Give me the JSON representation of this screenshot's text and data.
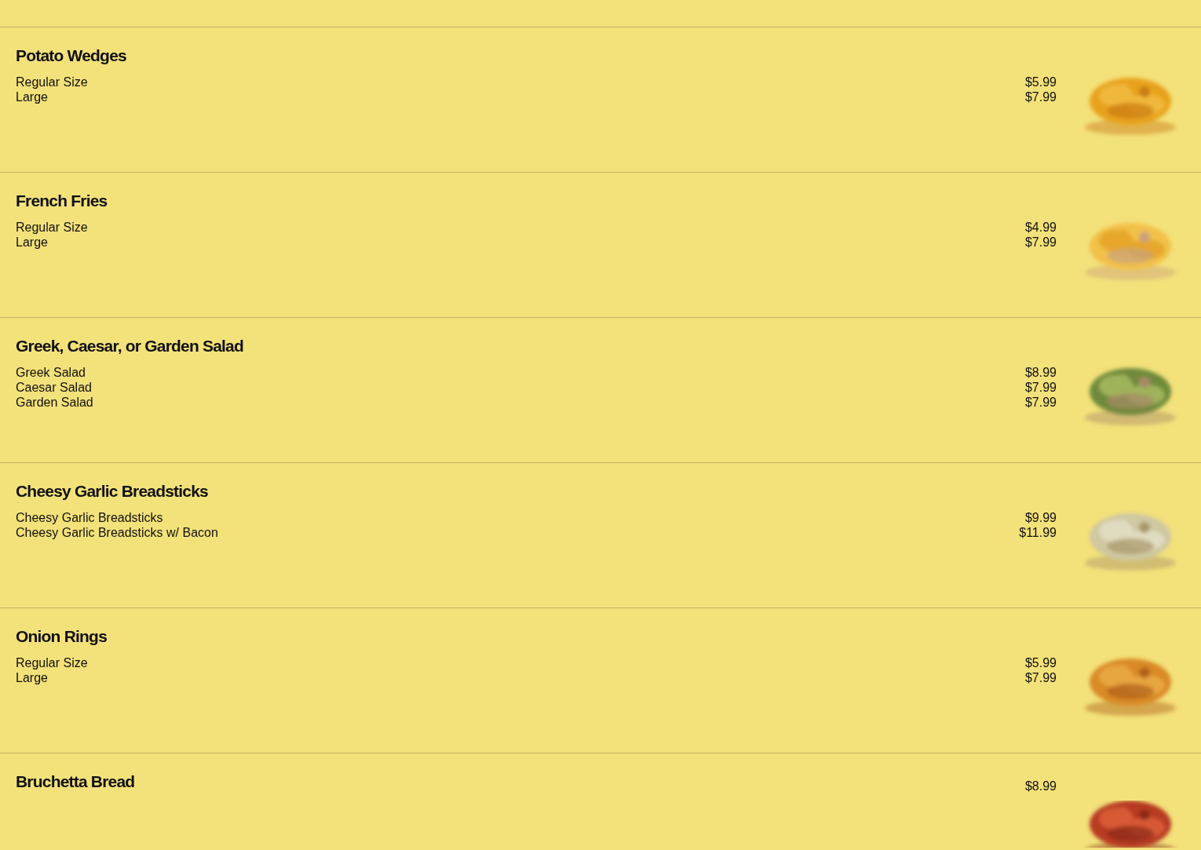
{
  "sections": [
    {
      "title": "Potato Wedges",
      "items": [
        {
          "name": "Regular Size",
          "price": "$5.99"
        },
        {
          "name": "Large",
          "price": "$7.99"
        }
      ],
      "image": {
        "kind": "picture"
      }
    },
    {
      "title": "French Fries",
      "items": [
        {
          "name": "Regular Size",
          "price": "$4.99"
        },
        {
          "name": "Large",
          "price": "$7.99"
        }
      ],
      "image": {
        "kind": "picture"
      }
    },
    {
      "title": "Greek, Caesar, or Garden Salad",
      "items": [
        {
          "name": "Greek Salad",
          "price": "$8.99"
        },
        {
          "name": "Caesar Salad",
          "price": "$7.99"
        },
        {
          "name": "Garden Salad",
          "price": "$7.99"
        }
      ],
      "image": {
        "kind": "picture"
      }
    },
    {
      "title": "Cheesy Garlic Breadsticks",
      "items": [
        {
          "name": "Cheesy Garlic Breadsticks",
          "price": "$9.99"
        },
        {
          "name": "Cheesy Garlic Breadsticks w/ Bacon",
          "price": "$11.99"
        }
      ],
      "image": {
        "kind": "picture"
      }
    },
    {
      "title": "Onion Rings",
      "items": [
        {
          "name": "Regular Size",
          "price": "$5.99"
        },
        {
          "name": "Large",
          "price": "$7.99"
        }
      ],
      "image": {
        "kind": "picture"
      }
    },
    {
      "title": "Bruchetta Bread",
      "price": "$8.99",
      "image": {
        "kind": "picture"
      }
    }
  ]
}
